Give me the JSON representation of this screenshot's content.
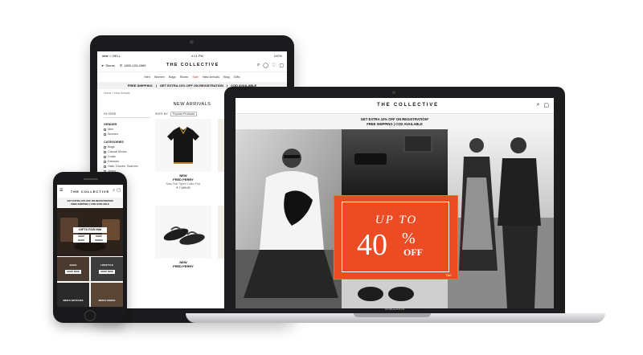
{
  "brand": "THE COLLECTIVE",
  "tablet": {
    "status": {
      "carrier": "●●●○○ BELL",
      "time": "4:21 PM",
      "battery": "100%"
    },
    "header": {
      "stores_label": "Stores",
      "phone": "1800-103-4989"
    },
    "nav": [
      "Men",
      "Women",
      "Bags",
      "Shoes",
      "Sale",
      "New Arrivals",
      "Blog",
      "Gifts"
    ],
    "promo": [
      "FREE SHIPPING",
      "GET EXTRA 10% OFF ON REGISTRATION",
      "COD AVAILABLE"
    ],
    "breadcrumb": "Home > New Arrivals",
    "page_title": "NEW ARRIVALS",
    "filters_label": "FILTERS",
    "sort_label": "SORT BY",
    "sort_value": "Popular Products",
    "gender": {
      "heading": "GENDER",
      "options": [
        "Men",
        "Women"
      ]
    },
    "categories": {
      "heading": "CATEGORIES",
      "options": [
        "Bags",
        "Casual Shoes",
        "Coats",
        "Dresses",
        "Hats, Gloves, Scarves",
        "Jeans"
      ]
    },
    "products": [
      {
        "badge": "NEW",
        "brand": "FRED PERRY",
        "name": "Navy Twin Tipped Cotton Polo",
        "price": "₹ 7,499.00"
      },
      {
        "badge": "NEW",
        "brand": "FRED PERRY",
        "name": "",
        "price": ""
      }
    ]
  },
  "laptop": {
    "promo_line1": "GET EXTRA 10% OFF ON REGISTRATION*",
    "promo_line2": "FREE SHIPPING  |  COD AVAILABLE",
    "offer_top": "UP TO",
    "offer_value": "40",
    "offer_pct": "%",
    "offer_off": "OFF",
    "offer_note": "T&C",
    "device_label": "MacBook"
  },
  "phone": {
    "promo_line1": "GET EXTRA 10% OFF ON REGISTRATION",
    "promo_line2": "FREE SHIPPING  |  COD AVAILABLE",
    "hero_title": "GIFTS FOR HIM",
    "hero_buttons": [
      "SHOP BAGS",
      "SHOP SHOES"
    ],
    "tiles": [
      {
        "label": "BAGS",
        "button": "SHOP NOW"
      },
      {
        "label": "LIFESTYLE",
        "button": "SHOP NOW"
      }
    ],
    "bottom_tiles": [
      "MEN'S WATCHES",
      "MEN'S SHOES"
    ]
  },
  "colors": {
    "accent": "#ec4b24",
    "sale": "#c0392b",
    "frame": "#1b1b1d"
  },
  "icons": [
    "search-icon",
    "user-icon",
    "heart-icon",
    "bag-icon",
    "menu-icon",
    "location-icon",
    "phone-icon"
  ]
}
